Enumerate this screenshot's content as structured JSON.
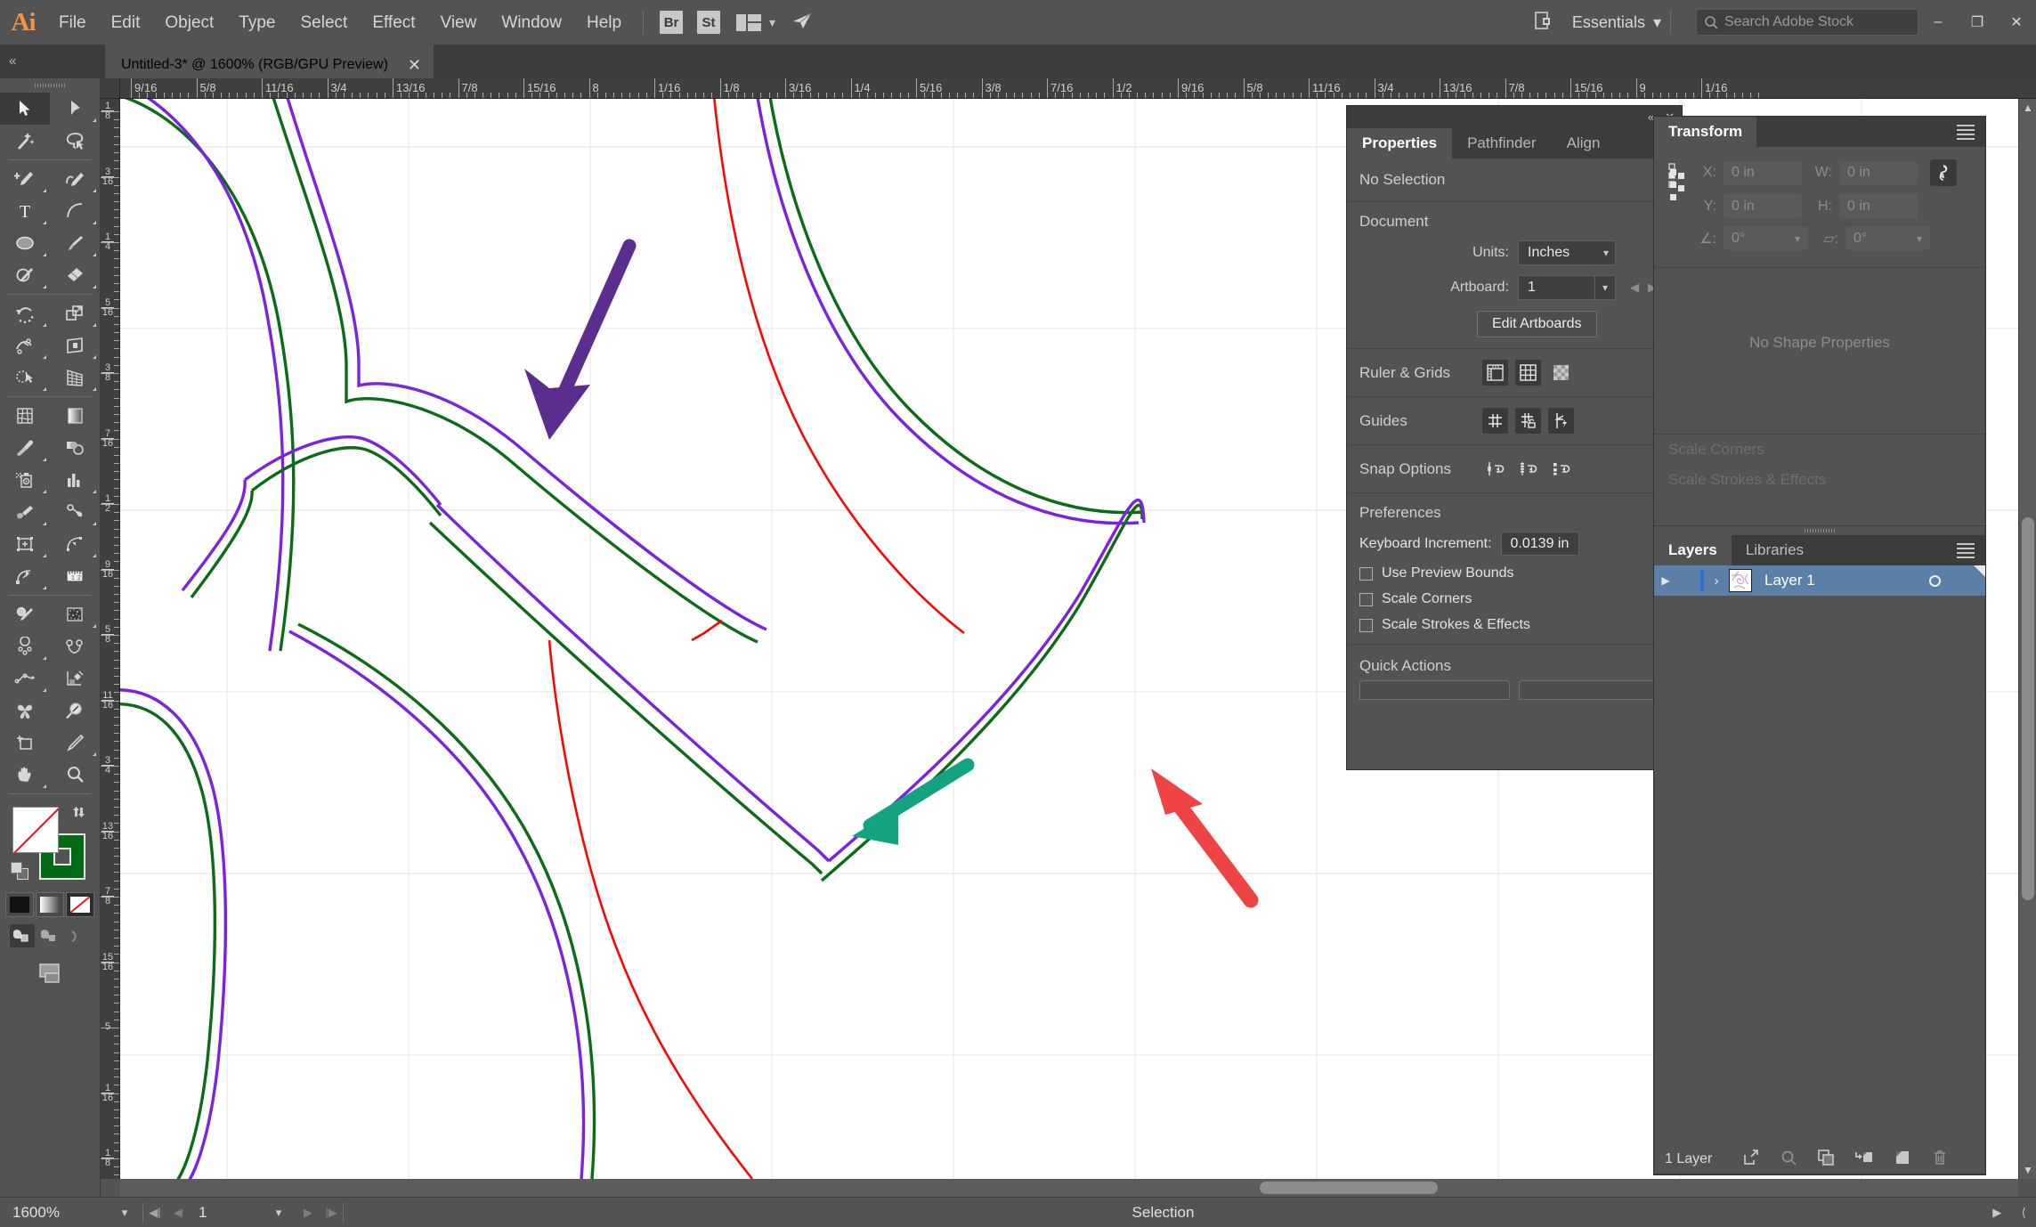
{
  "app": {
    "name": "Adobe Illustrator",
    "logo_text": "Ai",
    "menus": [
      "File",
      "Edit",
      "Object",
      "Type",
      "Select",
      "Effect",
      "View",
      "Window",
      "Help"
    ],
    "quick_launch": [
      "Br",
      "St"
    ],
    "workspace": "Essentials",
    "search_placeholder": "Search Adobe Stock",
    "window_buttons": {
      "minimize": "–",
      "maximize": "❐",
      "close": "✕"
    }
  },
  "document": {
    "tab_title": "Untitled-3* @ 1600% (RGB/GPU Preview)",
    "close_label": "✕"
  },
  "rulers": {
    "horizontal_labels": [
      "9/16",
      "5/8",
      "11/16",
      "3/4",
      "13/16",
      "7/8",
      "15/16",
      "8",
      "1/16",
      "1/8",
      "3/16",
      "1/4",
      "5/16",
      "3/8",
      "7/16",
      "1/2",
      "9/16",
      "5/8",
      "11/16",
      "3/4",
      "13/16",
      "7/8",
      "15/16",
      "9",
      "1/16"
    ],
    "vertical_labels": [
      "1/8",
      "3/16",
      "1/4",
      "5/16",
      "3/8",
      "7/16",
      "1/2",
      "9/16",
      "5/8",
      "11/16",
      "3/4",
      "13/16",
      "7/8",
      "15/16",
      "5",
      "1/16",
      "1/8"
    ]
  },
  "toolbar": {
    "tools": [
      {
        "name": "selection-tool",
        "active": true
      },
      {
        "name": "direct-selection-tool",
        "active": false
      },
      {
        "name": "magic-wand-tool",
        "active": false
      },
      {
        "name": "lasso-tool",
        "active": false
      },
      {
        "name": "pen-tool",
        "active": false
      },
      {
        "name": "curvature-tool",
        "active": false
      },
      {
        "name": "type-tool",
        "active": false
      },
      {
        "name": "line-segment-tool",
        "active": false
      },
      {
        "name": "ellipse-tool",
        "active": false
      },
      {
        "name": "paintbrush-tool",
        "active": false
      },
      {
        "name": "shaper-tool",
        "active": false
      },
      {
        "name": "eraser-tool",
        "active": false
      },
      {
        "name": "rotate-tool",
        "active": false
      },
      {
        "name": "scale-tool",
        "active": false
      },
      {
        "name": "width-tool",
        "active": false
      },
      {
        "name": "free-transform-tool",
        "active": false
      },
      {
        "name": "shape-builder-tool",
        "active": false
      },
      {
        "name": "perspective-grid-tool",
        "active": false
      },
      {
        "name": "mesh-tool",
        "active": false
      },
      {
        "name": "gradient-tool",
        "active": false
      },
      {
        "name": "eyedropper-tool",
        "active": false
      },
      {
        "name": "blend-tool",
        "active": false
      },
      {
        "name": "symbol-sprayer-tool",
        "active": false
      },
      {
        "name": "column-graph-tool",
        "active": false
      },
      {
        "name": "artboard-tool",
        "active": false
      },
      {
        "name": "slice-tool",
        "active": false
      },
      {
        "name": "puppet-warp-tool",
        "active": false
      },
      {
        "name": "measure-tool",
        "active": false
      },
      {
        "name": "live-paint-bucket-tool",
        "active": false
      },
      {
        "name": "pattern-tool",
        "active": false
      },
      {
        "name": "scissors-tool",
        "active": false
      },
      {
        "name": "join-tool",
        "active": false
      },
      {
        "name": "pencil-tool",
        "active": false
      },
      {
        "name": "reshape-tool",
        "active": false
      },
      {
        "name": "blob-brush-tool",
        "active": false
      },
      {
        "name": "zoom-region-tool",
        "active": false
      },
      {
        "name": "crop-image-tool",
        "active": false
      },
      {
        "name": "knife-tool",
        "active": false
      },
      {
        "name": "hand-tool",
        "active": false
      },
      {
        "name": "zoom-tool",
        "active": false
      }
    ],
    "fill_color": "#ffffff",
    "fill_is_none": true,
    "stroke_color": "#046a16",
    "color_modes": [
      "color",
      "gradient",
      "none"
    ],
    "selected_color_mode": "none",
    "draw_modes": [
      "draw-normal",
      "draw-behind",
      "draw-inside"
    ],
    "selected_draw_mode": "draw-normal"
  },
  "properties_panel": {
    "tabs": [
      "Properties",
      "Pathfinder",
      "Align"
    ],
    "active_tab": "Properties",
    "selection_status": "No Selection",
    "document_section": {
      "title": "Document",
      "units_label": "Units:",
      "units_value": "Inches",
      "artboard_label": "Artboard:",
      "artboard_value": "1",
      "edit_artboards_button": "Edit Artboards"
    },
    "ruler_grids": {
      "label": "Ruler & Grids",
      "icons": [
        "show-rulers-icon",
        "show-grid-icon",
        "show-transparency-grid-icon"
      ]
    },
    "guides": {
      "label": "Guides",
      "icons": [
        "show-guides-icon",
        "lock-guides-icon",
        "smart-guides-icon"
      ]
    },
    "snap_options": {
      "label": "Snap Options",
      "icons": [
        "snap-to-point-icon",
        "snap-to-grid-icon",
        "snap-to-pixel-icon"
      ]
    },
    "preferences": {
      "title": "Preferences",
      "keyboard_increment_label": "Keyboard Increment:",
      "keyboard_increment_value": "0.0139 in",
      "checkboxes": [
        {
          "label": "Use Preview Bounds",
          "checked": false
        },
        {
          "label": "Scale Corners",
          "checked": false
        },
        {
          "label": "Scale Strokes & Effects",
          "checked": false
        }
      ]
    },
    "quick_actions": {
      "title": "Quick Actions"
    }
  },
  "right_dock": {
    "transform": {
      "tab_label": "Transform",
      "x_label": "X:",
      "x_value": "0 in",
      "y_label": "Y:",
      "y_value": "0 in",
      "w_label": "W:",
      "w_value": "0 in",
      "h_label": "H:",
      "h_value": "0 in",
      "rotate_label": "∠:",
      "rotate_value": "0°",
      "shear_label": "▱:",
      "shear_value": "0°",
      "no_shape_properties": "No Shape Properties",
      "ghost_items": [
        "Scale Corners",
        "Scale Strokes & Effects"
      ]
    },
    "layers": {
      "tabs": [
        "Layers",
        "Libraries"
      ],
      "active_tab": "Layers",
      "rows": [
        {
          "name": "Layer 1",
          "selected": true,
          "visible": true,
          "locked": false
        }
      ],
      "footer_count": "1 Layer",
      "footer_icons": [
        "release-to-layers-icon",
        "locate-object-icon",
        "make-sublayer-icon",
        "create-sublayer-icon",
        "new-layer-icon",
        "delete-layer-icon"
      ]
    }
  },
  "status_bar": {
    "zoom_level": "1600%",
    "page_number": "1",
    "tool_status": "Selection"
  },
  "annotations": [
    {
      "name": "purple-arrow",
      "color": "#5b2d8e",
      "points_to": "path-corner-vertex"
    },
    {
      "name": "teal-arrow",
      "color": "#13a383",
      "points_to": "purple-outer-path"
    },
    {
      "name": "red-arrow",
      "color": "#ee4444",
      "points_to": "red-path"
    }
  ],
  "artwork": {
    "stroke_colors": {
      "purple": "#7b22e0",
      "green": "#0b6b16",
      "red": "#fa0505"
    },
    "grid_color": "#ebebeb",
    "background": "#ffffff"
  }
}
